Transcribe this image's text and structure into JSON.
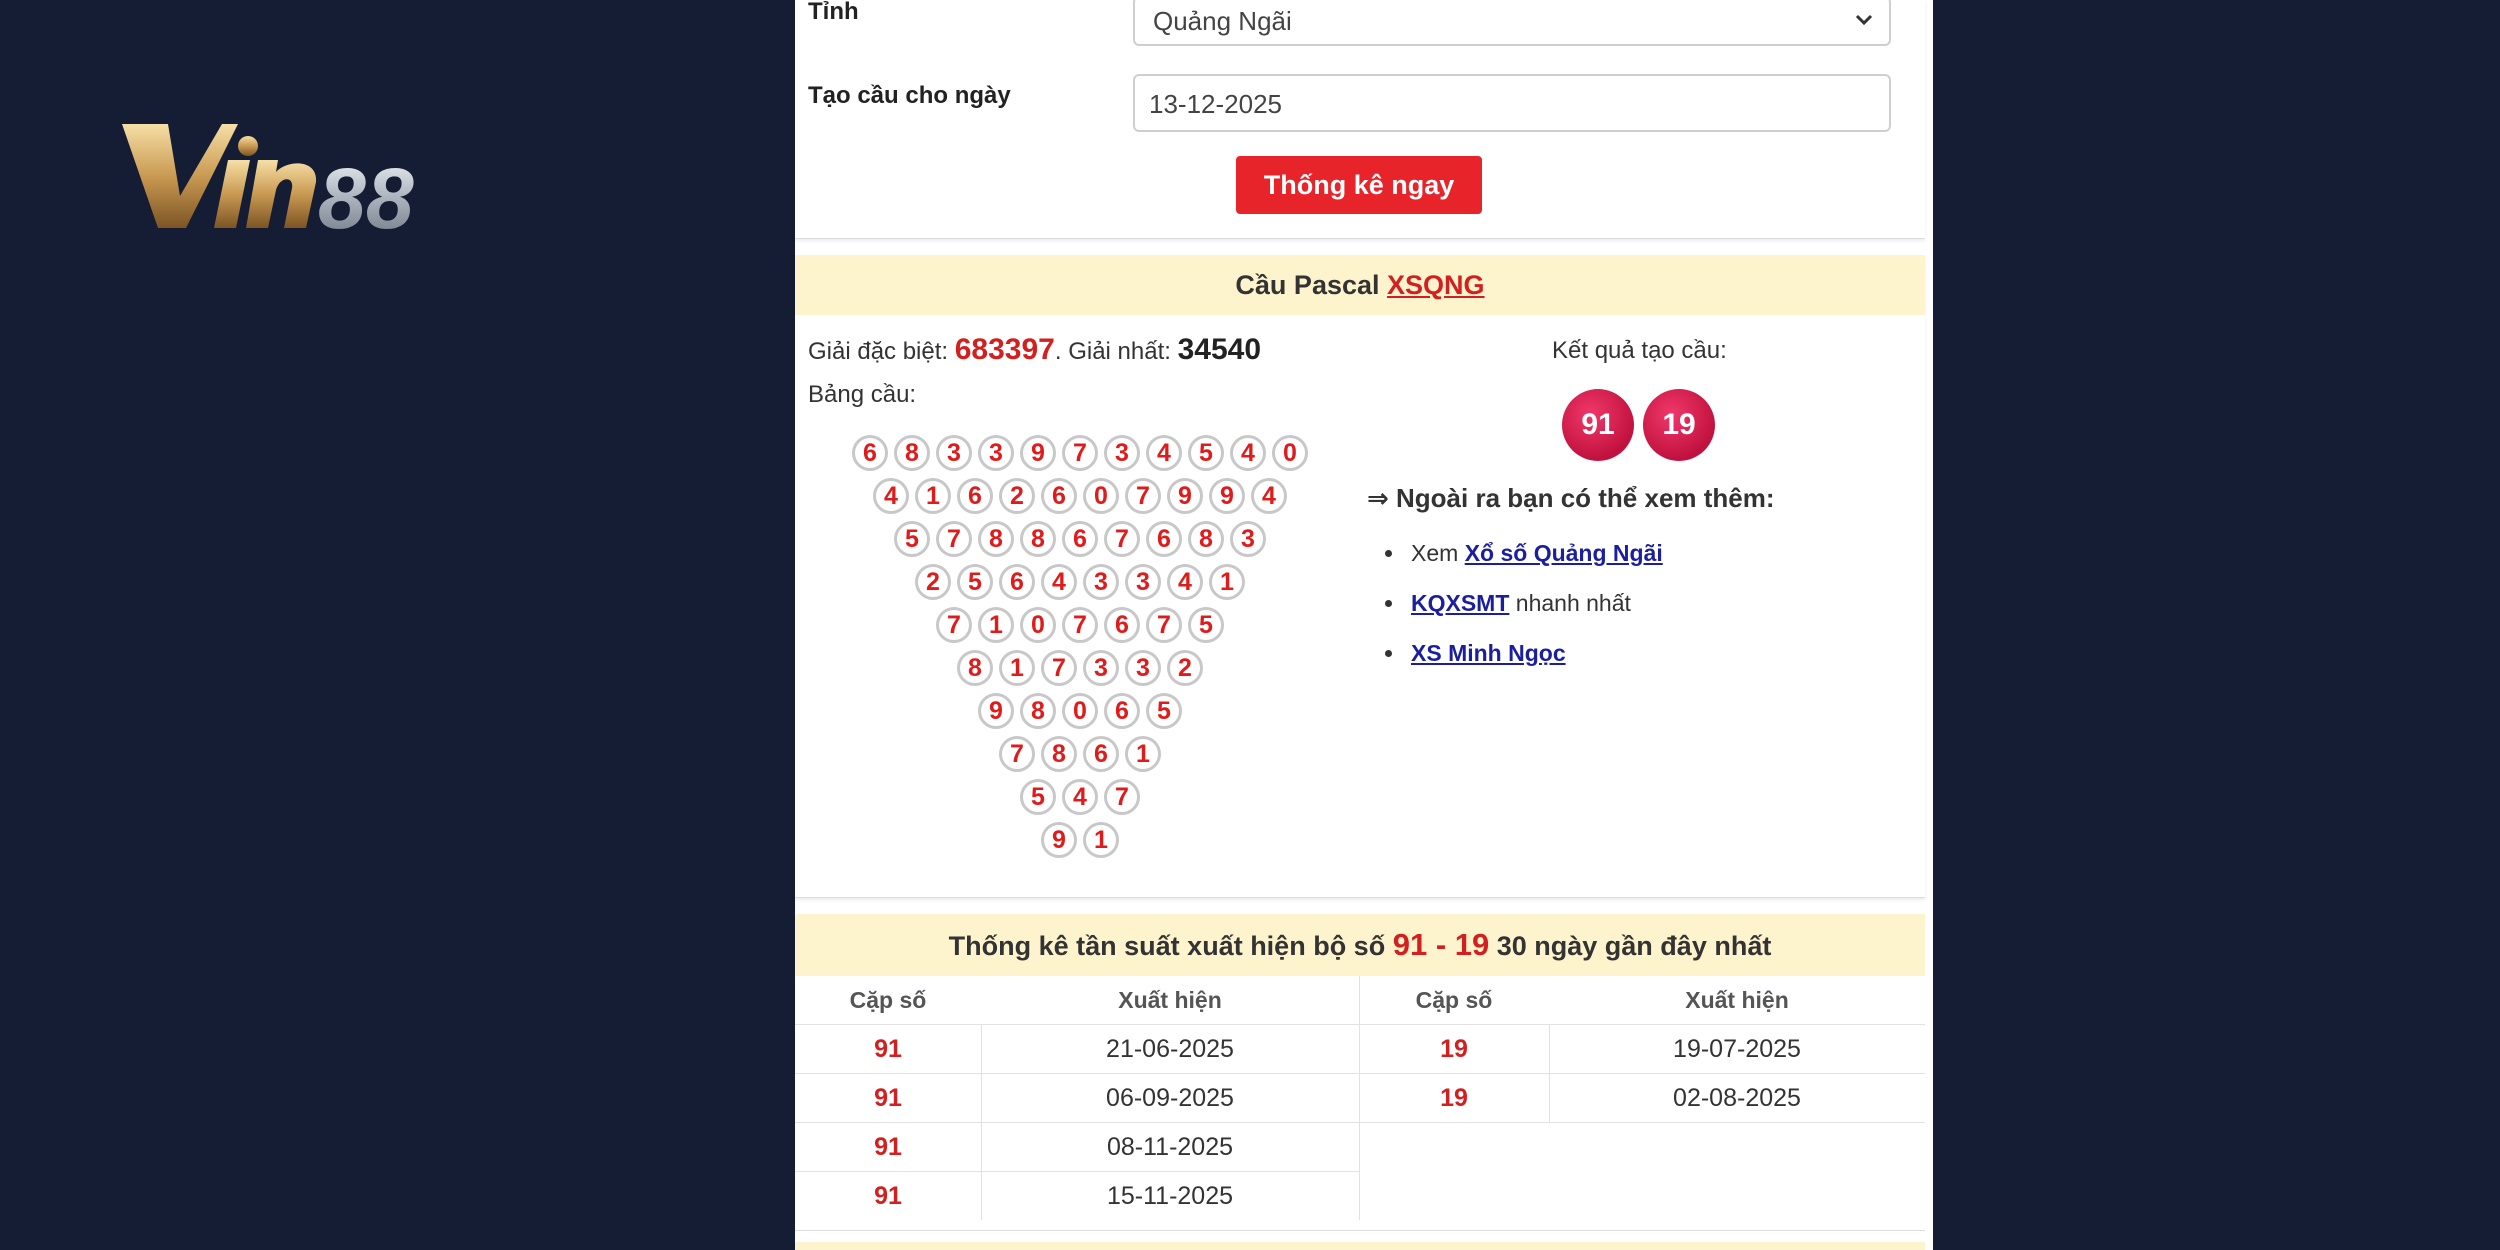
{
  "brand": {
    "logo_text": "Vin88"
  },
  "form": {
    "province_label": "Tỉnh",
    "province_value": "Quảng Ngãi",
    "date_label": "Tạo cầu cho ngày",
    "date_value": "13-12-2025",
    "submit_label": "Thống kê ngay"
  },
  "pascal": {
    "title_prefix": "Cầu Pascal",
    "title_link": "XSQNG",
    "special_label": "Giải đặc biệt:",
    "special_value": "683397",
    "first_label": ". Giải nhất:",
    "first_value": "34540",
    "table_label": "Bảng cầu:",
    "rows": [
      [
        "6",
        "8",
        "3",
        "3",
        "9",
        "7",
        "3",
        "4",
        "5",
        "4",
        "0"
      ],
      [
        "4",
        "1",
        "6",
        "2",
        "6",
        "0",
        "7",
        "9",
        "9",
        "4"
      ],
      [
        "5",
        "7",
        "8",
        "8",
        "6",
        "7",
        "6",
        "8",
        "3"
      ],
      [
        "2",
        "5",
        "6",
        "4",
        "3",
        "3",
        "4",
        "1"
      ],
      [
        "7",
        "1",
        "0",
        "7",
        "6",
        "7",
        "5"
      ],
      [
        "8",
        "1",
        "7",
        "3",
        "3",
        "2"
      ],
      [
        "9",
        "8",
        "0",
        "6",
        "5"
      ],
      [
        "7",
        "8",
        "6",
        "1"
      ],
      [
        "5",
        "4",
        "7"
      ],
      [
        "9",
        "1"
      ]
    ],
    "result_label": "Kết quả tạo cầu:",
    "results": [
      "91",
      "19"
    ],
    "more_title": "⇒ Ngoài ra bạn có thể xem thêm:",
    "more_links": [
      {
        "prefix": "Xem ",
        "link": "Xổ số Quảng Ngãi",
        "suffix": ""
      },
      {
        "prefix": "",
        "link": "KQXSMT",
        "suffix": " nhanh nhất"
      },
      {
        "prefix": "",
        "link": "XS Minh Ngọc",
        "suffix": ""
      }
    ]
  },
  "frequency": {
    "title_prefix": "Thống kê tần suất xuất hiện bộ số",
    "title_pair": "91 - 19",
    "title_suffix": "30 ngày gần đây nhất",
    "col_pair": "Cặp số",
    "col_seen": "Xuất hiện",
    "left_rows": [
      {
        "pair": "91",
        "date": "21-06-2025"
      },
      {
        "pair": "91",
        "date": "06-09-2025"
      },
      {
        "pair": "91",
        "date": "08-11-2025"
      },
      {
        "pair": "91",
        "date": "15-11-2025"
      }
    ],
    "right_rows": [
      {
        "pair": "19",
        "date": "19-07-2025"
      },
      {
        "pair": "19",
        "date": "02-08-2025"
      }
    ]
  },
  "colors": {
    "accent_red": "#e8242b",
    "header_bg": "#fdf3cd",
    "page_bg": "#141d33",
    "ball_red": "#c1123f"
  },
  "icons": {
    "logo": "vin88-logo",
    "select": "chevron-down-icon"
  }
}
